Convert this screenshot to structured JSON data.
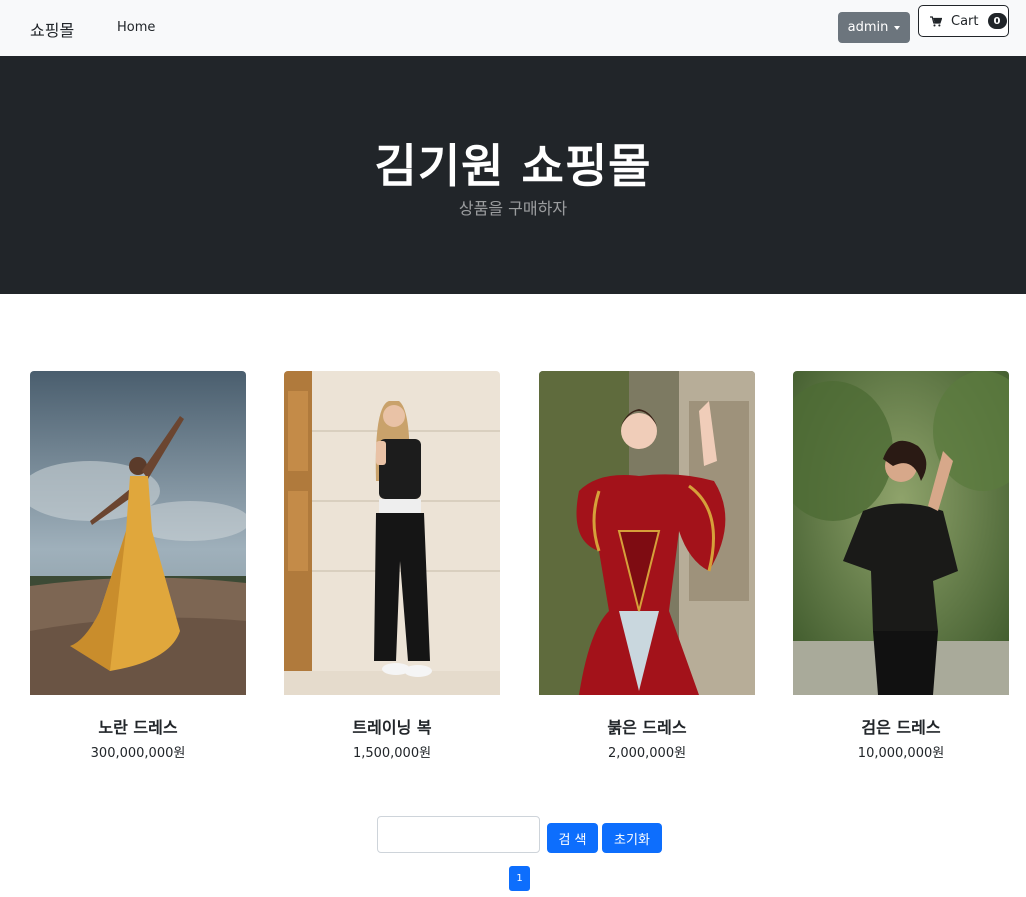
{
  "navbar": {
    "brand": "쇼핑몰",
    "home_label": "Home",
    "user_menu_label": "admin",
    "cart_label": "Cart",
    "cart_count": "0"
  },
  "hero": {
    "title": "김기원 쇼핑몰",
    "subtitle": "상품을 구매하자"
  },
  "products": [
    {
      "name": "노란 드레스",
      "price": "300,000,000원"
    },
    {
      "name": "트레이닝 복",
      "price": "1,500,000원"
    },
    {
      "name": "붉은 드레스",
      "price": "2,000,000원"
    },
    {
      "name": "검은 드레스",
      "price": "10,000,000원"
    }
  ],
  "search": {
    "value": "",
    "placeholder": "",
    "search_label": "검 색",
    "reset_label": "초기화"
  },
  "pagination": {
    "current_page": "1"
  },
  "colors": {
    "navbar_bg": "#f8f9fa",
    "hero_bg": "#212529",
    "primary": "#0d6efd",
    "secondary": "#6c757d"
  }
}
